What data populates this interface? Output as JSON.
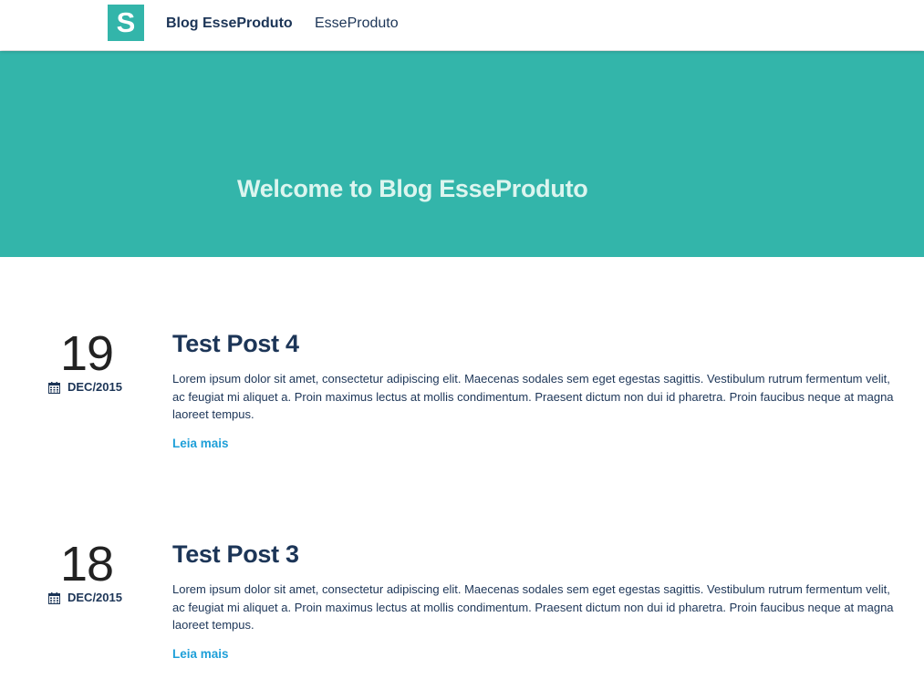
{
  "navbar": {
    "logo_letter": "S",
    "brand": "Blog EsseProduto",
    "link": "EsseProduto"
  },
  "hero": {
    "title": "Welcome to Blog EsseProduto"
  },
  "posts": [
    {
      "day": "19",
      "month": "DEC/2015",
      "title": "Test Post 4",
      "excerpt": "Lorem ipsum dolor sit amet, consectetur adipiscing elit. Maecenas sodales sem eget egestas sagittis. Vestibulum rutrum fermentum velit, ac feugiat mi aliquet a. Proin maximus lectus at mollis condimentum. Praesent dictum non dui id pharetra. Proin faucibus neque at magna laoreet tempus.",
      "read_more": "Leia mais"
    },
    {
      "day": "18",
      "month": "DEC/2015",
      "title": "Test Post 3",
      "excerpt": "Lorem ipsum dolor sit amet, consectetur adipiscing elit. Maecenas sodales sem eget egestas sagittis. Vestibulum rutrum fermentum velit, ac feugiat mi aliquet a. Proin maximus lectus at mollis condimentum. Praesent dictum non dui id pharetra. Proin faucibus neque at magna laoreet tempus.",
      "read_more": "Leia mais"
    }
  ],
  "icons": {
    "calendar": "calendar-icon"
  },
  "colors": {
    "accent": "#33b5aa",
    "navy": "#1c3557",
    "link": "#1e9fd8",
    "hero_text": "#dcf5ef"
  }
}
